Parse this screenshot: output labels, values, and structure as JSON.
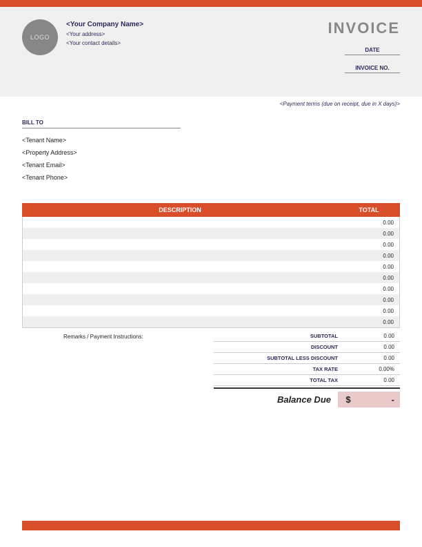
{
  "logo_text": "LOGO",
  "company": {
    "name": "<Your Company Name>",
    "address": "<Your address>",
    "contact": "<Your contact details>"
  },
  "invoice": {
    "title": "INVOICE",
    "date_label": "DATE",
    "number_label": "INVOICE NO."
  },
  "payment_terms": "<Payment terms (due on receipt, due in X days)>",
  "bill_to": {
    "label": "BILL TO",
    "name": "<Tenant Name>",
    "address": "<Property Address>",
    "email": "<Tenant Email>",
    "phone": "<Tenant Phone>"
  },
  "table": {
    "header_desc": "DESCRIPTION",
    "header_total": "TOTAL",
    "rows": [
      {
        "desc": "",
        "total": "0.00"
      },
      {
        "desc": "",
        "total": "0.00"
      },
      {
        "desc": "",
        "total": "0.00"
      },
      {
        "desc": "",
        "total": "0.00"
      },
      {
        "desc": "",
        "total": "0.00"
      },
      {
        "desc": "",
        "total": "0.00"
      },
      {
        "desc": "",
        "total": "0.00"
      },
      {
        "desc": "",
        "total": "0.00"
      },
      {
        "desc": "",
        "total": "0.00"
      },
      {
        "desc": "",
        "total": "0.00"
      }
    ]
  },
  "remarks_label": "Remarks / Payment Instructions:",
  "totals": {
    "subtotal_label": "SUBTOTAL",
    "subtotal": "0.00",
    "discount_label": "DISCOUNT",
    "discount": "0.00",
    "less_label": "SUBTOTAL LESS DISCOUNT",
    "less": "0.00",
    "tax_rate_label": "TAX RATE",
    "tax_rate": "0.00%",
    "total_tax_label": "TOTAL TAX",
    "total_tax": "0.00"
  },
  "balance": {
    "label": "Balance Due",
    "currency": "$",
    "value": "-"
  }
}
